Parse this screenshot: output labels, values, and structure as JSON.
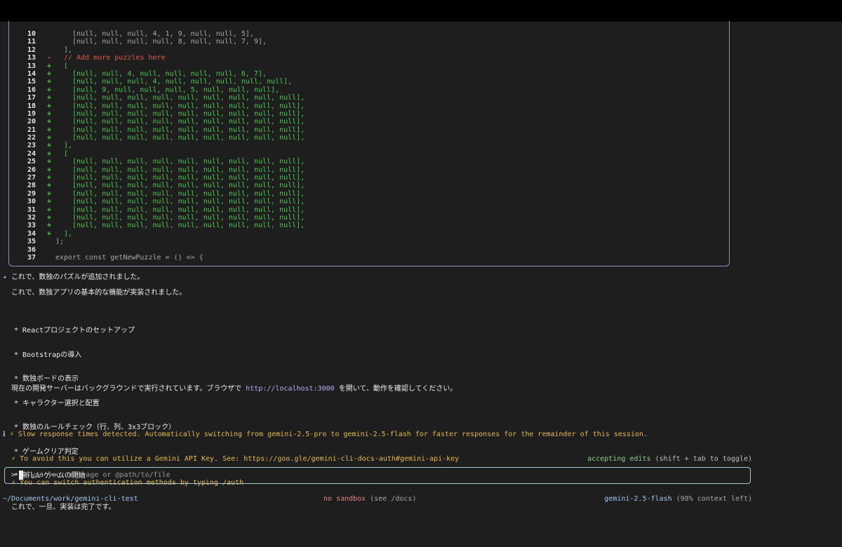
{
  "diff": {
    "lines": [
      {
        "num": "10",
        "mark": "",
        "type": "ctx",
        "code": "    [null, null, null, 4, 1, 9, null, null, 5],"
      },
      {
        "num": "11",
        "mark": "",
        "type": "ctx",
        "code": "    [null, null, null, null, 8, null, null, 7, 9],"
      },
      {
        "num": "12",
        "mark": "",
        "type": "ctx",
        "code": "  ],"
      },
      {
        "num": "13",
        "mark": "-",
        "type": "del",
        "code": "  // Add more puzzles here"
      },
      {
        "num": "13",
        "mark": "+",
        "type": "add",
        "code": "  ["
      },
      {
        "num": "14",
        "mark": "+",
        "type": "add",
        "code": "    [null, null, 4, null, null, null, null, 6, 7],"
      },
      {
        "num": "15",
        "mark": "+",
        "type": "add",
        "code": "    [null, null, null, 4, null, null, null, null, null],"
      },
      {
        "num": "16",
        "mark": "+",
        "type": "add",
        "code": "    [null, 9, null, null, null, 5, null, null, null],"
      },
      {
        "num": "17",
        "mark": "+",
        "type": "add",
        "code": "    [null, null, null, null, null, null, null, null, null],"
      },
      {
        "num": "18",
        "mark": "+",
        "type": "add",
        "code": "    [null, null, null, null, null, null, null, null, null],"
      },
      {
        "num": "19",
        "mark": "+",
        "type": "add",
        "code": "    [null, null, null, null, null, null, null, null, null],"
      },
      {
        "num": "20",
        "mark": "+",
        "type": "add",
        "code": "    [null, null, null, null, null, null, null, null, null],"
      },
      {
        "num": "21",
        "mark": "+",
        "type": "add",
        "code": "    [null, null, null, null, null, null, null, null, null],"
      },
      {
        "num": "22",
        "mark": "+",
        "type": "add",
        "code": "    [null, null, null, null, null, null, null, null, null],"
      },
      {
        "num": "23",
        "mark": "+",
        "type": "add",
        "code": "  ],"
      },
      {
        "num": "24",
        "mark": "+",
        "type": "add",
        "code": "  ["
      },
      {
        "num": "25",
        "mark": "+",
        "type": "add",
        "code": "    [null, null, null, null, null, null, null, null, null],"
      },
      {
        "num": "26",
        "mark": "+",
        "type": "add",
        "code": "    [null, null, null, null, null, null, null, null, null],"
      },
      {
        "num": "27",
        "mark": "+",
        "type": "add",
        "code": "    [null, null, null, null, null, null, null, null, null],"
      },
      {
        "num": "28",
        "mark": "+",
        "type": "add",
        "code": "    [null, null, null, null, null, null, null, null, null],"
      },
      {
        "num": "29",
        "mark": "+",
        "type": "add",
        "code": "    [null, null, null, null, null, null, null, null, null],"
      },
      {
        "num": "30",
        "mark": "+",
        "type": "add",
        "code": "    [null, null, null, null, null, null, null, null, null],"
      },
      {
        "num": "31",
        "mark": "+",
        "type": "add",
        "code": "    [null, null, null, null, null, null, null, null, null],"
      },
      {
        "num": "32",
        "mark": "+",
        "type": "add",
        "code": "    [null, null, null, null, null, null, null, null, null],"
      },
      {
        "num": "33",
        "mark": "+",
        "type": "add",
        "code": "    [null, null, null, null, null, null, null, null, null],"
      },
      {
        "num": "34",
        "mark": "+",
        "type": "add",
        "code": "  ],"
      },
      {
        "num": "35",
        "mark": "",
        "type": "ctx",
        "code": "];"
      },
      {
        "num": "36",
        "mark": "",
        "type": "ctx",
        "code": ""
      },
      {
        "num": "37",
        "mark": "",
        "type": "ctx",
        "code": "export const getNewPuzzle = () => {"
      }
    ]
  },
  "response": {
    "bullet": "✦",
    "line1": "これで、数独のパズルが追加されました。",
    "line2": "これで、数独アプリの基本的な機能が実装されました。",
    "features": [
      "* Reactプロジェクトのセットアップ",
      "* Bootstrapの導入",
      "* 数独ボードの表示",
      "* キャラクター選択と配置",
      "* 数独のルールチェック（行、列、3x3ブロック）",
      "* ゲームクリア判定",
      "* 新しいゲームの開始"
    ],
    "server_prefix": "現在の開発サーバーはバックグラウンドで実行されています。ブラウザで ",
    "server_url": "http://localhost:3000",
    "server_suffix": " を開いて、動作を確認してください。"
  },
  "info": {
    "icon": "ℹ",
    "bolt": "⚡",
    "line1": "Slow response times detected. Automatically switching from gemini-2.5-pro to gemini-2.5-flash for faster responses for the remainder of this session.",
    "line2": "To avoid this you can utilize a Gemini API Key. See: https://goo.gle/gemini-cli-docs-auth#gemini-api-key",
    "line3": "You can switch authentication methods by typing /auth",
    "done": "これで、一旦、実装は完了です。"
  },
  "mode": {
    "label": "accepting edits",
    "hint": "(shift + tab to toggle)"
  },
  "input": {
    "prompt": ">",
    "placeholder": "Type your message or @path/to/file"
  },
  "footer": {
    "path": "~/Documents/work/gemini-cli-test",
    "sandbox": "no sandbox",
    "sandbox_hint": "(see /docs)",
    "model": "gemini-2.5-flash",
    "context": "(98% context left)"
  },
  "colors": {
    "added": "#4ec94e",
    "removed": "#e05a4b",
    "warning": "#e8b84a",
    "accent": "#b9a7f5",
    "path": "#9fc5f1"
  }
}
